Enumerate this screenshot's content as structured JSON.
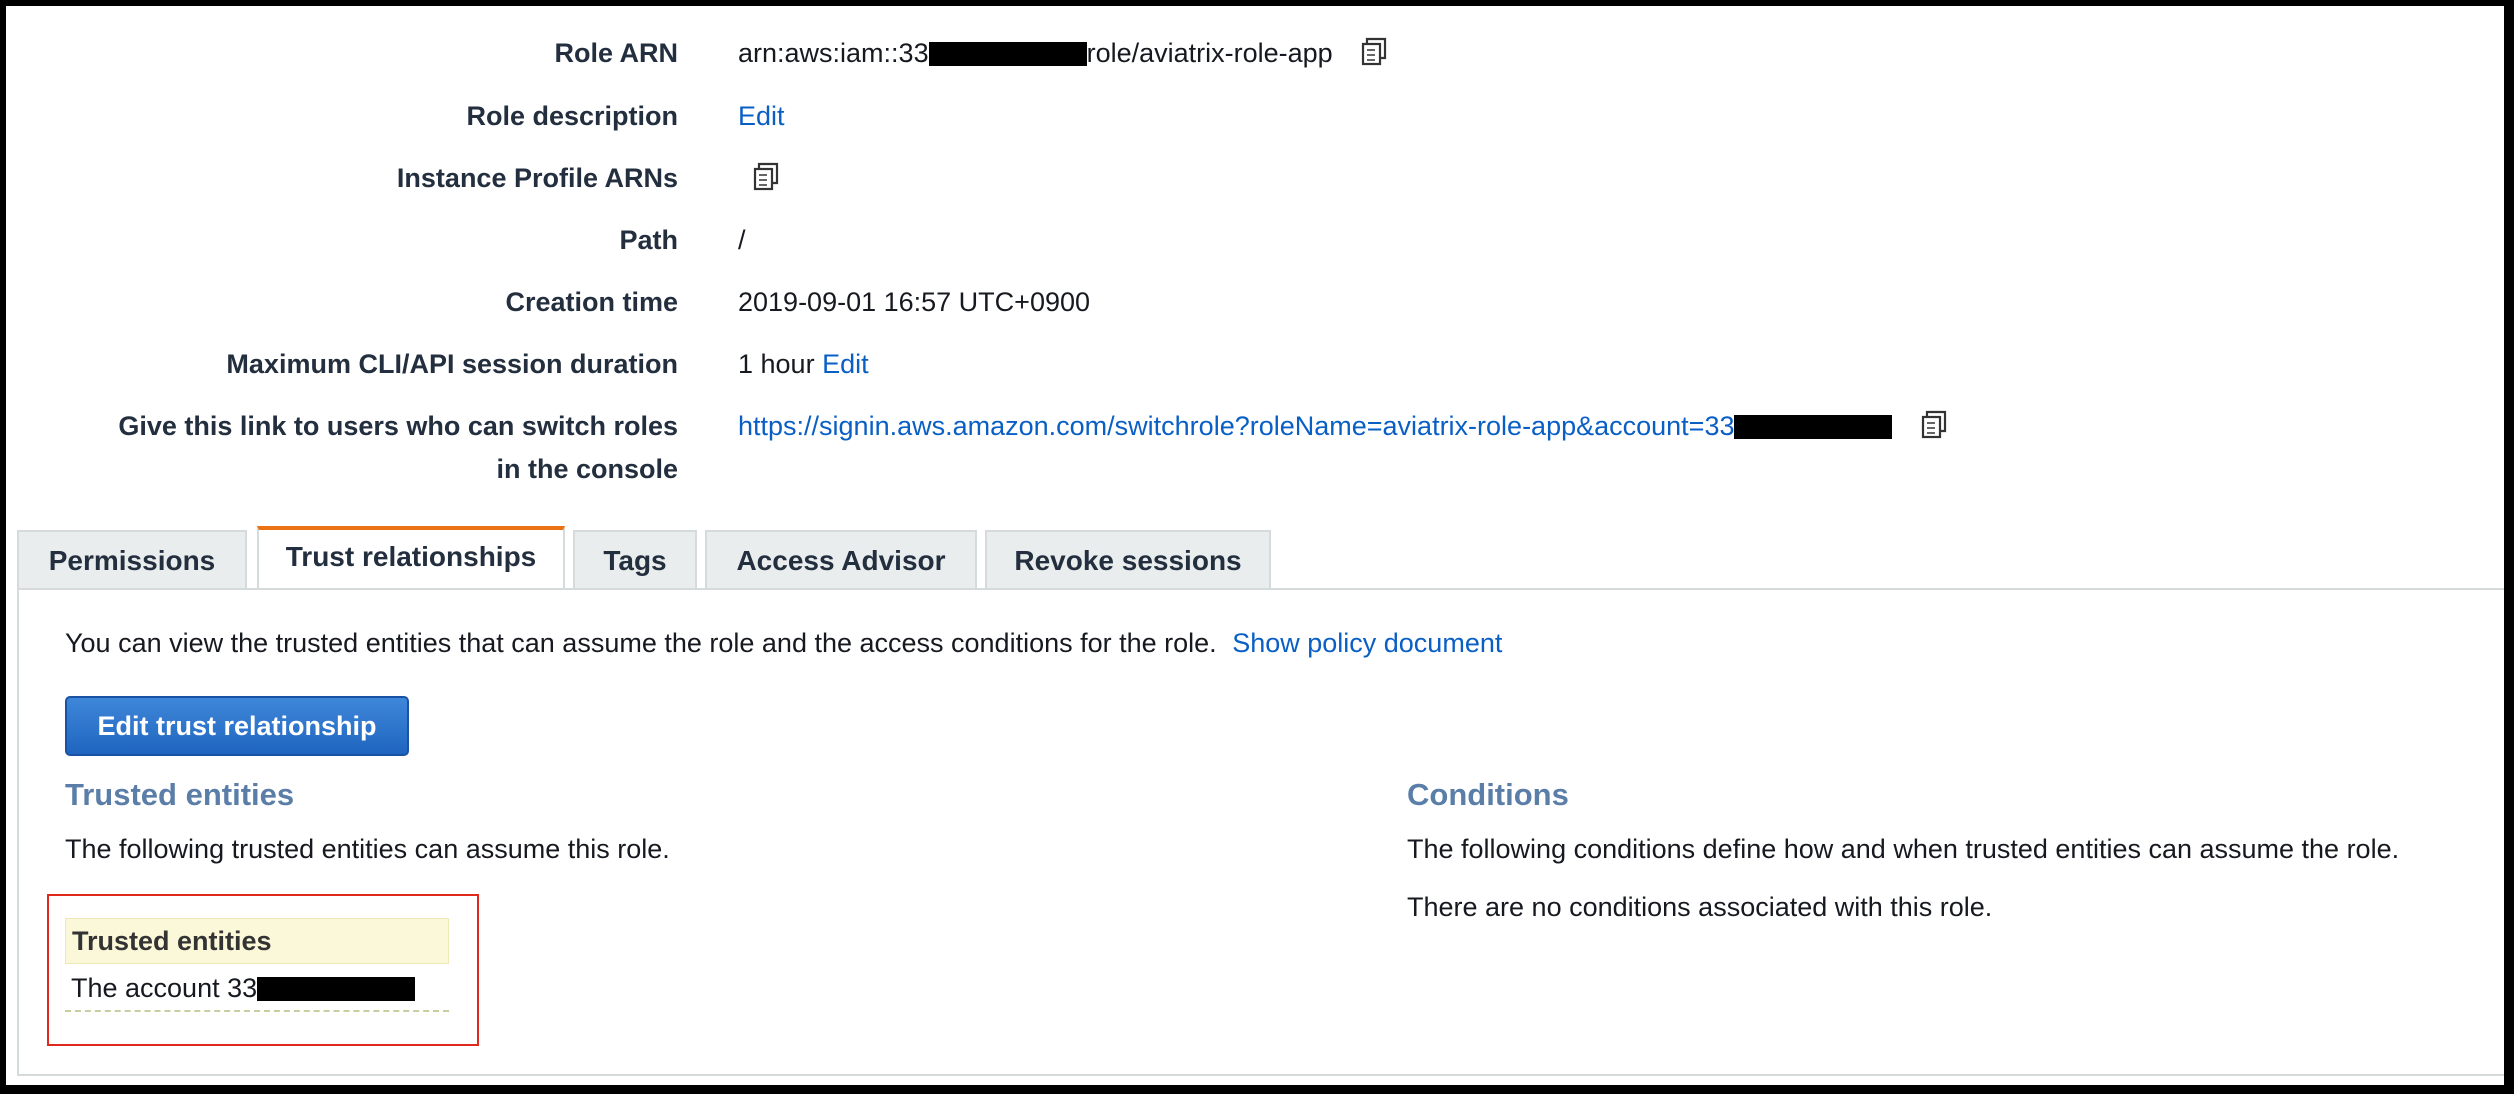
{
  "summary": {
    "role_arn": {
      "label": "Role ARN",
      "prefix": "arn:aws:iam::33",
      "suffix": "role/aviatrix-role-app"
    },
    "role_description": {
      "label": "Role description",
      "action": "Edit"
    },
    "instance_profile": {
      "label": "Instance Profile ARNs"
    },
    "path": {
      "label": "Path",
      "value": "/"
    },
    "creation_time": {
      "label": "Creation time",
      "value": "2019-09-01 16:57 UTC+0900"
    },
    "max_session": {
      "label": "Maximum CLI/API session duration",
      "value": "1 hour",
      "action": "Edit"
    },
    "switch_link": {
      "label_line1": "Give this link to users who can switch roles",
      "label_line2": "in the console",
      "url_prefix": "https://signin.aws.amazon.com/switchrole?roleName=aviatrix-role-app&account=33"
    }
  },
  "tabs": [
    {
      "label": "Permissions",
      "active": false
    },
    {
      "label": "Trust relationships",
      "active": true
    },
    {
      "label": "Tags",
      "active": false
    },
    {
      "label": "Access Advisor",
      "active": false
    },
    {
      "label": "Revoke sessions",
      "active": false
    }
  ],
  "panel": {
    "intro_text": "You can view the trusted entities that can assume the role and the access conditions for the role.",
    "intro_link": "Show policy document",
    "edit_button": "Edit trust relationship",
    "trusted": {
      "title": "Trusted entities",
      "description": "The following trusted entities can assume this role.",
      "table_header": "Trusted entities",
      "entity_prefix": "The account 33"
    },
    "conditions": {
      "title": "Conditions",
      "description": "The following conditions define how and when trusted entities can assume the role.",
      "none_text": "There are no conditions associated with this role."
    }
  },
  "colors": {
    "link": "#0a5fc4",
    "active_tab_accent": "#ec7211",
    "section_title": "#5b7ea8",
    "button": "#1f65c0",
    "highlight_border": "#e0291c"
  },
  "icons": {
    "copy": "copy-icon"
  }
}
